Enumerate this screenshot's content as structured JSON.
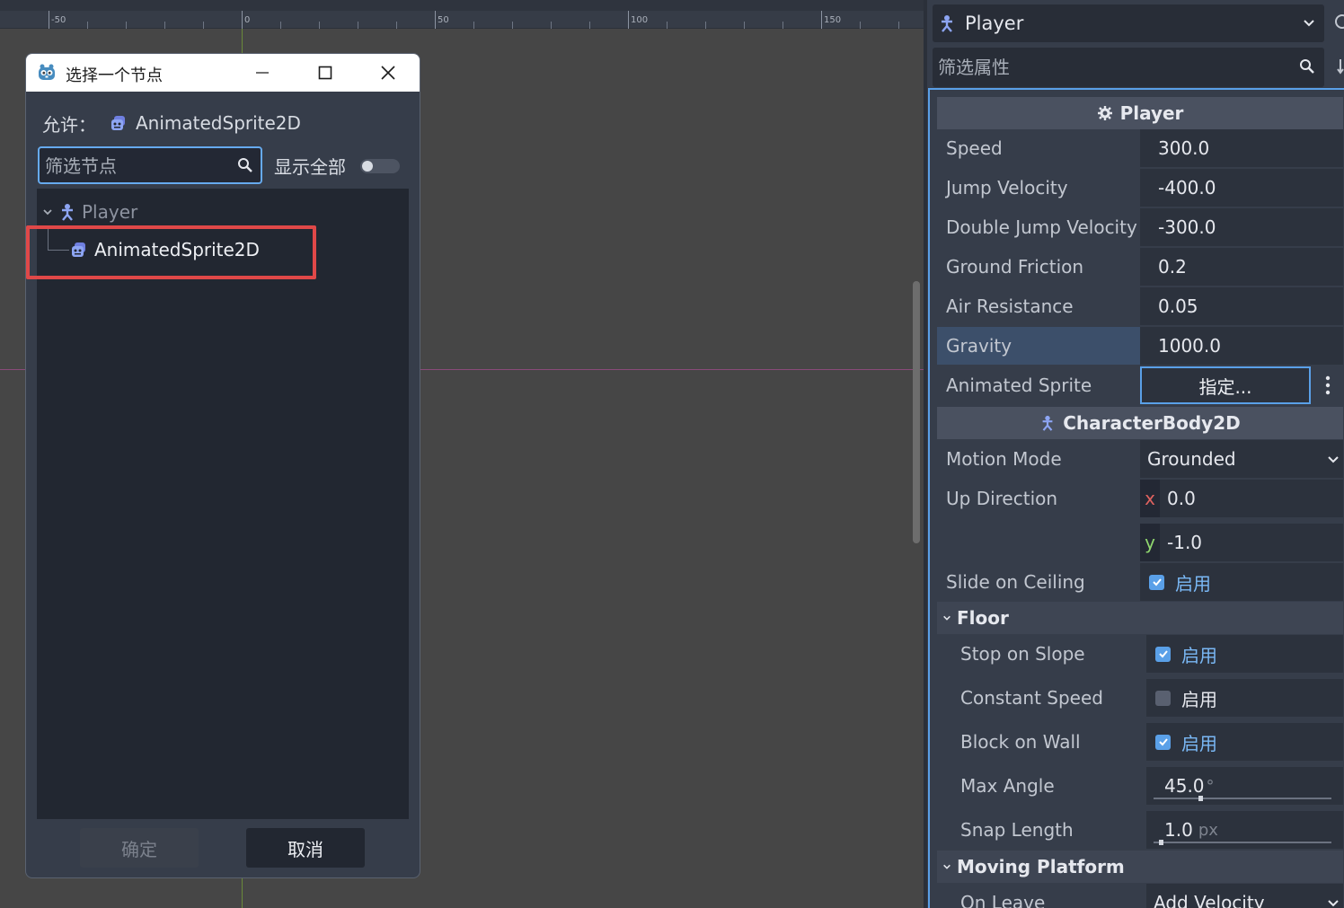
{
  "viewport": {
    "ruler_labels": [
      "-50",
      "0",
      "50",
      "100",
      "150"
    ]
  },
  "dialog": {
    "title": "选择一个节点",
    "allowed_label": "允许：",
    "allowed_type": "AnimatedSprite2D",
    "filter_placeholder": "筛选节点",
    "filter_value": "",
    "show_all_label": "显示全部",
    "show_all_on": false,
    "tree": {
      "root": "Player",
      "child": "AnimatedSprite2D"
    },
    "ok_label": "确定",
    "cancel_label": "取消"
  },
  "inspector": {
    "node_name": "Player",
    "filter_placeholder": "筛选属性",
    "script_section": "Player",
    "props": {
      "speed": {
        "label": "Speed",
        "value": "300.0"
      },
      "jump_velocity": {
        "label": "Jump Velocity",
        "value": "-400.0"
      },
      "double_jump_velocity": {
        "label": "Double Jump Velocity",
        "value": "-300.0"
      },
      "ground_friction": {
        "label": "Ground Friction",
        "value": "0.2"
      },
      "air_resistance": {
        "label": "Air Resistance",
        "value": "0.05"
      },
      "gravity": {
        "label": "Gravity",
        "value": "1000.0"
      },
      "animated_sprite": {
        "label": "Animated Sprite",
        "value": "指定..."
      }
    },
    "class_section": "CharacterBody2D",
    "motion_mode": {
      "label": "Motion Mode",
      "value": "Grounded"
    },
    "up_direction": {
      "label": "Up Direction",
      "x_tag": "x",
      "x": "0.0",
      "y_tag": "y",
      "y": "-1.0"
    },
    "slide_on_ceiling": {
      "label": "Slide on Ceiling",
      "value": "启用",
      "checked": true
    },
    "floor_group": "Floor",
    "floor": {
      "stop_on_slope": {
        "label": "Stop on Slope",
        "value": "启用",
        "checked": true
      },
      "constant_speed": {
        "label": "Constant Speed",
        "value": "启用",
        "checked": false
      },
      "block_on_wall": {
        "label": "Block on Wall",
        "value": "启用",
        "checked": true
      },
      "max_angle": {
        "label": "Max Angle",
        "value": "45.0",
        "unit": "°",
        "level": 0.25
      },
      "snap_length": {
        "label": "Snap Length",
        "value": "1.0",
        "unit": "px",
        "level": 0.03
      }
    },
    "moving_platform_group": "Moving Platform",
    "on_leave": {
      "label": "On Leave",
      "value": "Add Velocity"
    }
  }
}
